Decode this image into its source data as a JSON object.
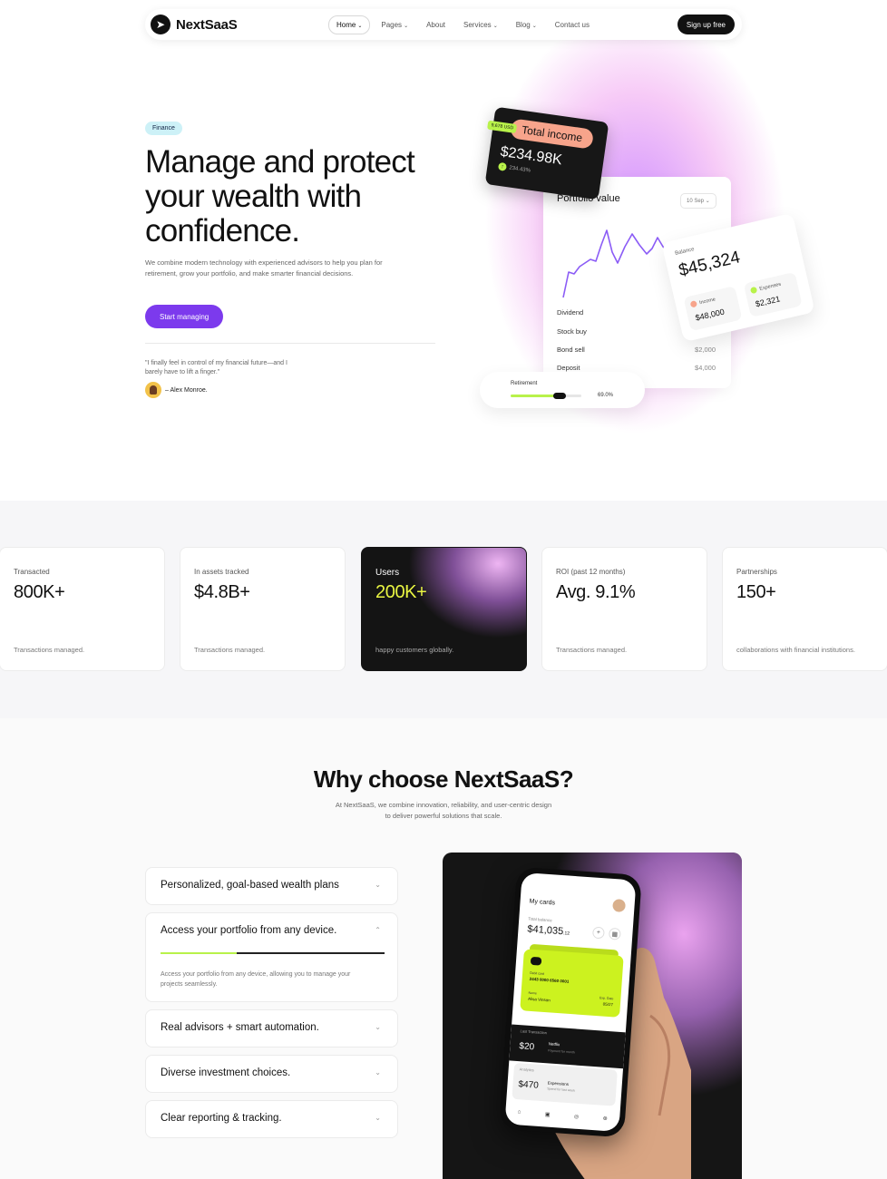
{
  "nav": {
    "logo_text": "NextSaaS",
    "links": [
      {
        "label": "Home",
        "dropdown": true,
        "active": true
      },
      {
        "label": "Pages",
        "dropdown": true
      },
      {
        "label": "About",
        "dropdown": false
      },
      {
        "label": "Services",
        "dropdown": true
      },
      {
        "label": "Blog",
        "dropdown": true
      },
      {
        "label": "Contact us",
        "dropdown": false
      }
    ],
    "cta": "Sign up free"
  },
  "hero": {
    "badge": "Finance",
    "title": "Manage and protect your wealth with confidence.",
    "description": "We combine modern technology with experienced advisors to help you plan for retirement, grow your portfolio, and make smarter financial decisions.",
    "cta": "Start managing",
    "quote": "\"I finally feel in control of my financial future—and I barely have to lift a finger.\"",
    "author": "– Alex Monroe.",
    "income_card": {
      "tag": "9,678 USD",
      "label": "Total income",
      "value": "$234.98K",
      "change": "234.43%"
    },
    "portfolio_card": {
      "title": "Portfolio value",
      "date": "10 Sep",
      "rows": [
        {
          "label": "Dividend",
          "amount": ""
        },
        {
          "label": "Stock buy",
          "amount": ""
        },
        {
          "label": "Bond sell",
          "amount": "$2,000"
        },
        {
          "label": "Deposit",
          "amount": "$4,000"
        }
      ]
    },
    "balance_card": {
      "label": "Balance",
      "value": "$45,324",
      "income_label": "Income",
      "income_value": "$48,000",
      "expenses_label": "Expenses",
      "expenses_value": "$2,321"
    },
    "retirement_card": {
      "label": "Retirement",
      "percent": "69.0%",
      "progress": 0.69
    }
  },
  "stats": [
    {
      "label": "Transacted",
      "value": "800K+",
      "desc": "Transactions managed."
    },
    {
      "label": "In assets tracked",
      "value": "$4.8B+",
      "desc": "Transactions managed."
    },
    {
      "label": "Users",
      "value": "200K+",
      "desc": "happy customers globally."
    },
    {
      "label": "ROI (past 12 months)",
      "value": "Avg. 9.1%",
      "desc": "Transactions managed."
    },
    {
      "label": "Partnerships",
      "value": "150+",
      "desc": "collaborations with financial institutions."
    }
  ],
  "why": {
    "title": "Why choose NextSaaS?",
    "subtitle": "At NextSaaS, we combine innovation, reliability, and user-centric design to deliver powerful solutions that scale.",
    "accordion": [
      {
        "question": "Personalized, goal-based wealth plans",
        "open": false
      },
      {
        "question": "Access your portfolio from any device.",
        "open": true,
        "answer": "Access your portfolio from any device, allowing you to manage your projects seamlessly.",
        "progress": 0.34
      },
      {
        "question": "Real advisors + smart automation.",
        "open": false
      },
      {
        "question": "Diverse investment choices.",
        "open": false
      },
      {
        "question": "Clear reporting & tracking.",
        "open": false
      }
    ],
    "phone": {
      "title": "My cards",
      "balance_label": "Total balance",
      "balance": "$41,035",
      "balance_cents": ".12",
      "card_small_label": "Debit card",
      "card_number": "2443 0000 6560 0001",
      "card_holder_label": "Name",
      "card_holder": "Alisa Vinson",
      "card_exp_label": "Exp. Date",
      "card_exp": "05/27",
      "tx_label": "Last Transaction",
      "tx_value": "$20",
      "tx_name": "Netflix",
      "tx_desc": "Payment for month",
      "an_label": "Analytics",
      "an_value": "$470",
      "an_name": "Expensions",
      "an_desc": "Spend for last week"
    }
  },
  "colors": {
    "accent_purple": "#7c3aed",
    "lime": "#b8f24a",
    "dark": "#141414"
  }
}
